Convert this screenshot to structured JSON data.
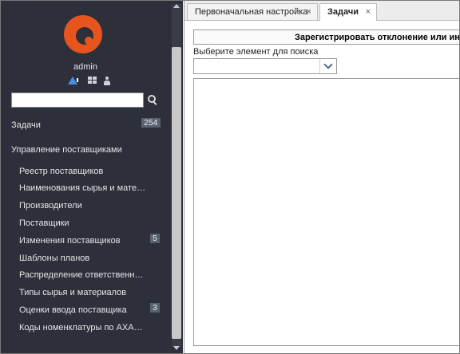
{
  "sidebar": {
    "username": "admin",
    "search": {
      "value": "",
      "placeholder": ""
    },
    "tasks": {
      "label": "Задачи",
      "count": "254"
    },
    "section": {
      "label": "Управление поставщиками"
    },
    "items": [
      {
        "label": "Реестр поставщиков"
      },
      {
        "label": "Наименования сырья и мате…"
      },
      {
        "label": "Производители"
      },
      {
        "label": "Поставщики"
      },
      {
        "label": "Изменения поставщиков",
        "badge": "5"
      },
      {
        "label": "Шаблоны планов"
      },
      {
        "label": "Распределение ответственн…"
      },
      {
        "label": "Типы сырья и материалов"
      },
      {
        "label": "Оценки ввода поставщика",
        "badge": "3"
      },
      {
        "label": "Коды номенклатуры по АХА…"
      }
    ]
  },
  "tabs": [
    {
      "label": "Первоначальная настройка",
      "close": "×"
    },
    {
      "label": "Задачи",
      "close": "×"
    }
  ],
  "main": {
    "register_button": "Зарегистрировать отклонение или инцидент",
    "select_label": "Выберите элемент для поиска",
    "select_value": ""
  },
  "colors": {
    "sidebar_bg": "#2d2f3b",
    "logo": "#e8541e",
    "warning_icon": "#4a90e2",
    "badge_bg": "#5a6170"
  }
}
